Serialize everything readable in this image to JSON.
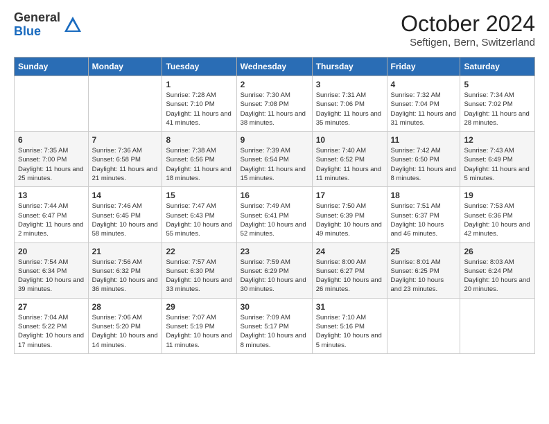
{
  "logo": {
    "general": "General",
    "blue": "Blue"
  },
  "header": {
    "month": "October 2024",
    "location": "Seftigen, Bern, Switzerland"
  },
  "days_of_week": [
    "Sunday",
    "Monday",
    "Tuesday",
    "Wednesday",
    "Thursday",
    "Friday",
    "Saturday"
  ],
  "weeks": [
    [
      {
        "day": "",
        "content": ""
      },
      {
        "day": "",
        "content": ""
      },
      {
        "day": "1",
        "content": "Sunrise: 7:28 AM\nSunset: 7:10 PM\nDaylight: 11 hours and 41 minutes."
      },
      {
        "day": "2",
        "content": "Sunrise: 7:30 AM\nSunset: 7:08 PM\nDaylight: 11 hours and 38 minutes."
      },
      {
        "day": "3",
        "content": "Sunrise: 7:31 AM\nSunset: 7:06 PM\nDaylight: 11 hours and 35 minutes."
      },
      {
        "day": "4",
        "content": "Sunrise: 7:32 AM\nSunset: 7:04 PM\nDaylight: 11 hours and 31 minutes."
      },
      {
        "day": "5",
        "content": "Sunrise: 7:34 AM\nSunset: 7:02 PM\nDaylight: 11 hours and 28 minutes."
      }
    ],
    [
      {
        "day": "6",
        "content": "Sunrise: 7:35 AM\nSunset: 7:00 PM\nDaylight: 11 hours and 25 minutes."
      },
      {
        "day": "7",
        "content": "Sunrise: 7:36 AM\nSunset: 6:58 PM\nDaylight: 11 hours and 21 minutes."
      },
      {
        "day": "8",
        "content": "Sunrise: 7:38 AM\nSunset: 6:56 PM\nDaylight: 11 hours and 18 minutes."
      },
      {
        "day": "9",
        "content": "Sunrise: 7:39 AM\nSunset: 6:54 PM\nDaylight: 11 hours and 15 minutes."
      },
      {
        "day": "10",
        "content": "Sunrise: 7:40 AM\nSunset: 6:52 PM\nDaylight: 11 hours and 11 minutes."
      },
      {
        "day": "11",
        "content": "Sunrise: 7:42 AM\nSunset: 6:50 PM\nDaylight: 11 hours and 8 minutes."
      },
      {
        "day": "12",
        "content": "Sunrise: 7:43 AM\nSunset: 6:49 PM\nDaylight: 11 hours and 5 minutes."
      }
    ],
    [
      {
        "day": "13",
        "content": "Sunrise: 7:44 AM\nSunset: 6:47 PM\nDaylight: 11 hours and 2 minutes."
      },
      {
        "day": "14",
        "content": "Sunrise: 7:46 AM\nSunset: 6:45 PM\nDaylight: 10 hours and 58 minutes."
      },
      {
        "day": "15",
        "content": "Sunrise: 7:47 AM\nSunset: 6:43 PM\nDaylight: 10 hours and 55 minutes."
      },
      {
        "day": "16",
        "content": "Sunrise: 7:49 AM\nSunset: 6:41 PM\nDaylight: 10 hours and 52 minutes."
      },
      {
        "day": "17",
        "content": "Sunrise: 7:50 AM\nSunset: 6:39 PM\nDaylight: 10 hours and 49 minutes."
      },
      {
        "day": "18",
        "content": "Sunrise: 7:51 AM\nSunset: 6:37 PM\nDaylight: 10 hours and 46 minutes."
      },
      {
        "day": "19",
        "content": "Sunrise: 7:53 AM\nSunset: 6:36 PM\nDaylight: 10 hours and 42 minutes."
      }
    ],
    [
      {
        "day": "20",
        "content": "Sunrise: 7:54 AM\nSunset: 6:34 PM\nDaylight: 10 hours and 39 minutes."
      },
      {
        "day": "21",
        "content": "Sunrise: 7:56 AM\nSunset: 6:32 PM\nDaylight: 10 hours and 36 minutes."
      },
      {
        "day": "22",
        "content": "Sunrise: 7:57 AM\nSunset: 6:30 PM\nDaylight: 10 hours and 33 minutes."
      },
      {
        "day": "23",
        "content": "Sunrise: 7:59 AM\nSunset: 6:29 PM\nDaylight: 10 hours and 30 minutes."
      },
      {
        "day": "24",
        "content": "Sunrise: 8:00 AM\nSunset: 6:27 PM\nDaylight: 10 hours and 26 minutes."
      },
      {
        "day": "25",
        "content": "Sunrise: 8:01 AM\nSunset: 6:25 PM\nDaylight: 10 hours and 23 minutes."
      },
      {
        "day": "26",
        "content": "Sunrise: 8:03 AM\nSunset: 6:24 PM\nDaylight: 10 hours and 20 minutes."
      }
    ],
    [
      {
        "day": "27",
        "content": "Sunrise: 7:04 AM\nSunset: 5:22 PM\nDaylight: 10 hours and 17 minutes."
      },
      {
        "day": "28",
        "content": "Sunrise: 7:06 AM\nSunset: 5:20 PM\nDaylight: 10 hours and 14 minutes."
      },
      {
        "day": "29",
        "content": "Sunrise: 7:07 AM\nSunset: 5:19 PM\nDaylight: 10 hours and 11 minutes."
      },
      {
        "day": "30",
        "content": "Sunrise: 7:09 AM\nSunset: 5:17 PM\nDaylight: 10 hours and 8 minutes."
      },
      {
        "day": "31",
        "content": "Sunrise: 7:10 AM\nSunset: 5:16 PM\nDaylight: 10 hours and 5 minutes."
      },
      {
        "day": "",
        "content": ""
      },
      {
        "day": "",
        "content": ""
      }
    ]
  ]
}
